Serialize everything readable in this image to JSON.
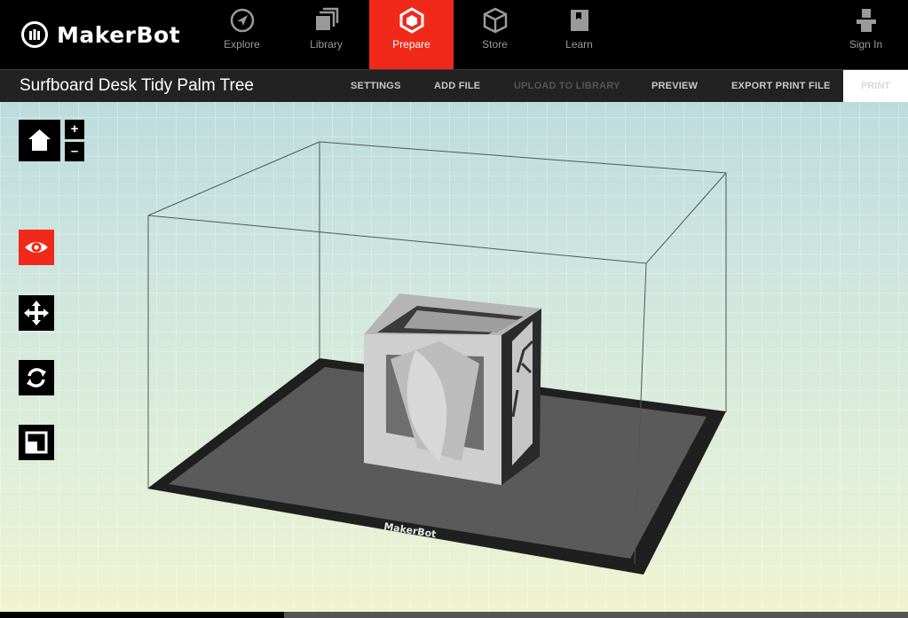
{
  "brand": {
    "name": "MakerBot"
  },
  "nav": {
    "items": [
      {
        "label": "Explore",
        "icon": "compass-icon"
      },
      {
        "label": "Library",
        "icon": "library-icon"
      },
      {
        "label": "Prepare",
        "icon": "prepare-cube-icon",
        "active": true
      },
      {
        "label": "Store",
        "icon": "store-box-icon"
      },
      {
        "label": "Learn",
        "icon": "book-icon"
      }
    ],
    "sign_in": "Sign In"
  },
  "project": {
    "title": "Surfboard Desk Tidy Palm Tree"
  },
  "actions": {
    "settings": "SETTINGS",
    "add_file": "ADD FILE",
    "upload": "UPLOAD TO LIBRARY",
    "preview": "PREVIEW",
    "export": "EXPORT PRINT FILE",
    "print": "PRINT"
  },
  "viewport": {
    "platform_brand": "MakerBot",
    "zoom_in": "+",
    "zoom_out": "–",
    "tools": [
      "home-view-icon",
      "eye-icon",
      "move-arrows-icon",
      "rotate-icon",
      "scale-icon"
    ]
  },
  "colors": {
    "accent": "#f0291a",
    "topbar": "#000000",
    "titlebar": "#222222"
  }
}
